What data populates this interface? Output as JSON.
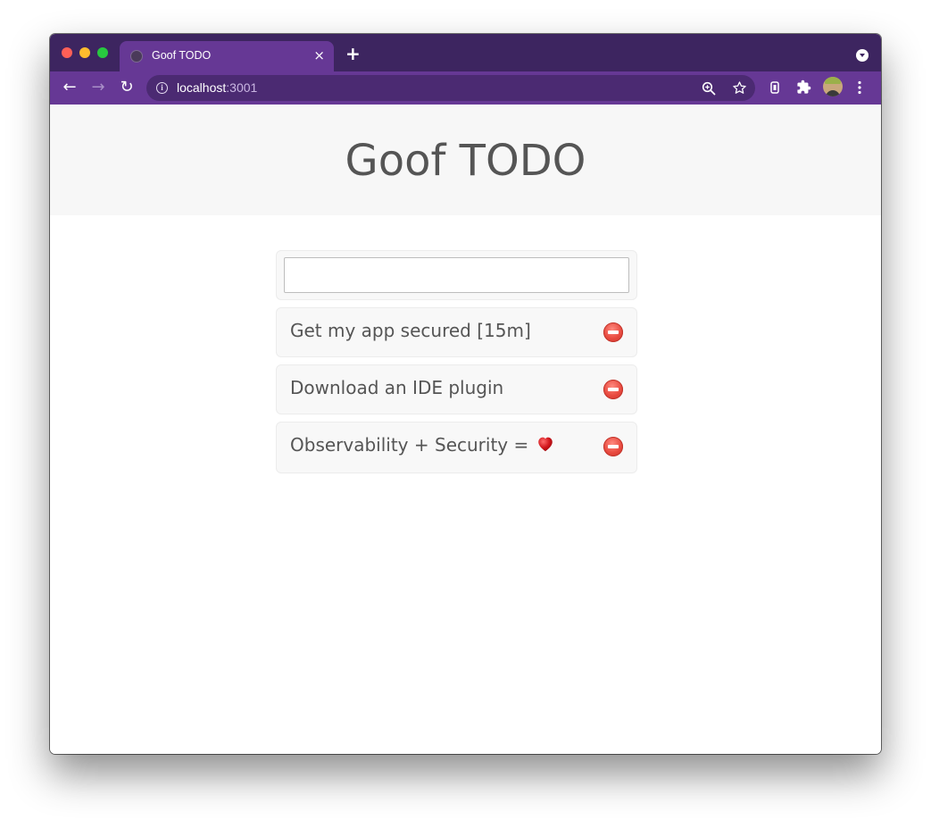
{
  "browser": {
    "tab": {
      "title": "Goof TODO",
      "close_glyph": "×",
      "favicon": "globe-icon"
    },
    "new_tab_glyph": "+",
    "address": {
      "host": "localhost",
      "port": ":3001"
    },
    "nav": {
      "back_glyph": "←",
      "forward_glyph": "→",
      "reload_glyph": "↻"
    },
    "omnibox_icons": [
      "zoom-icon",
      "star-icon"
    ],
    "extensions": [
      "extension-icon",
      "puzzle-icon",
      "avatar",
      "menu-icon"
    ],
    "colors": {
      "tabstrip": "#3d2560",
      "toolbar": "#663895",
      "omnibox": "#4b2a72"
    }
  },
  "app": {
    "title": "Goof TODO",
    "input": {
      "value": "",
      "placeholder": ""
    },
    "todos": [
      {
        "text": "Get my app secured [15m]"
      },
      {
        "text": "Download an IDE plugin"
      },
      {
        "text": "Observability + Security =",
        "suffix_icon": "heart-icon"
      }
    ],
    "colors": {
      "header_bg": "#f7f7f7",
      "text": "#555555",
      "delete": "#e84a3f",
      "heart": "#d0151b"
    }
  }
}
